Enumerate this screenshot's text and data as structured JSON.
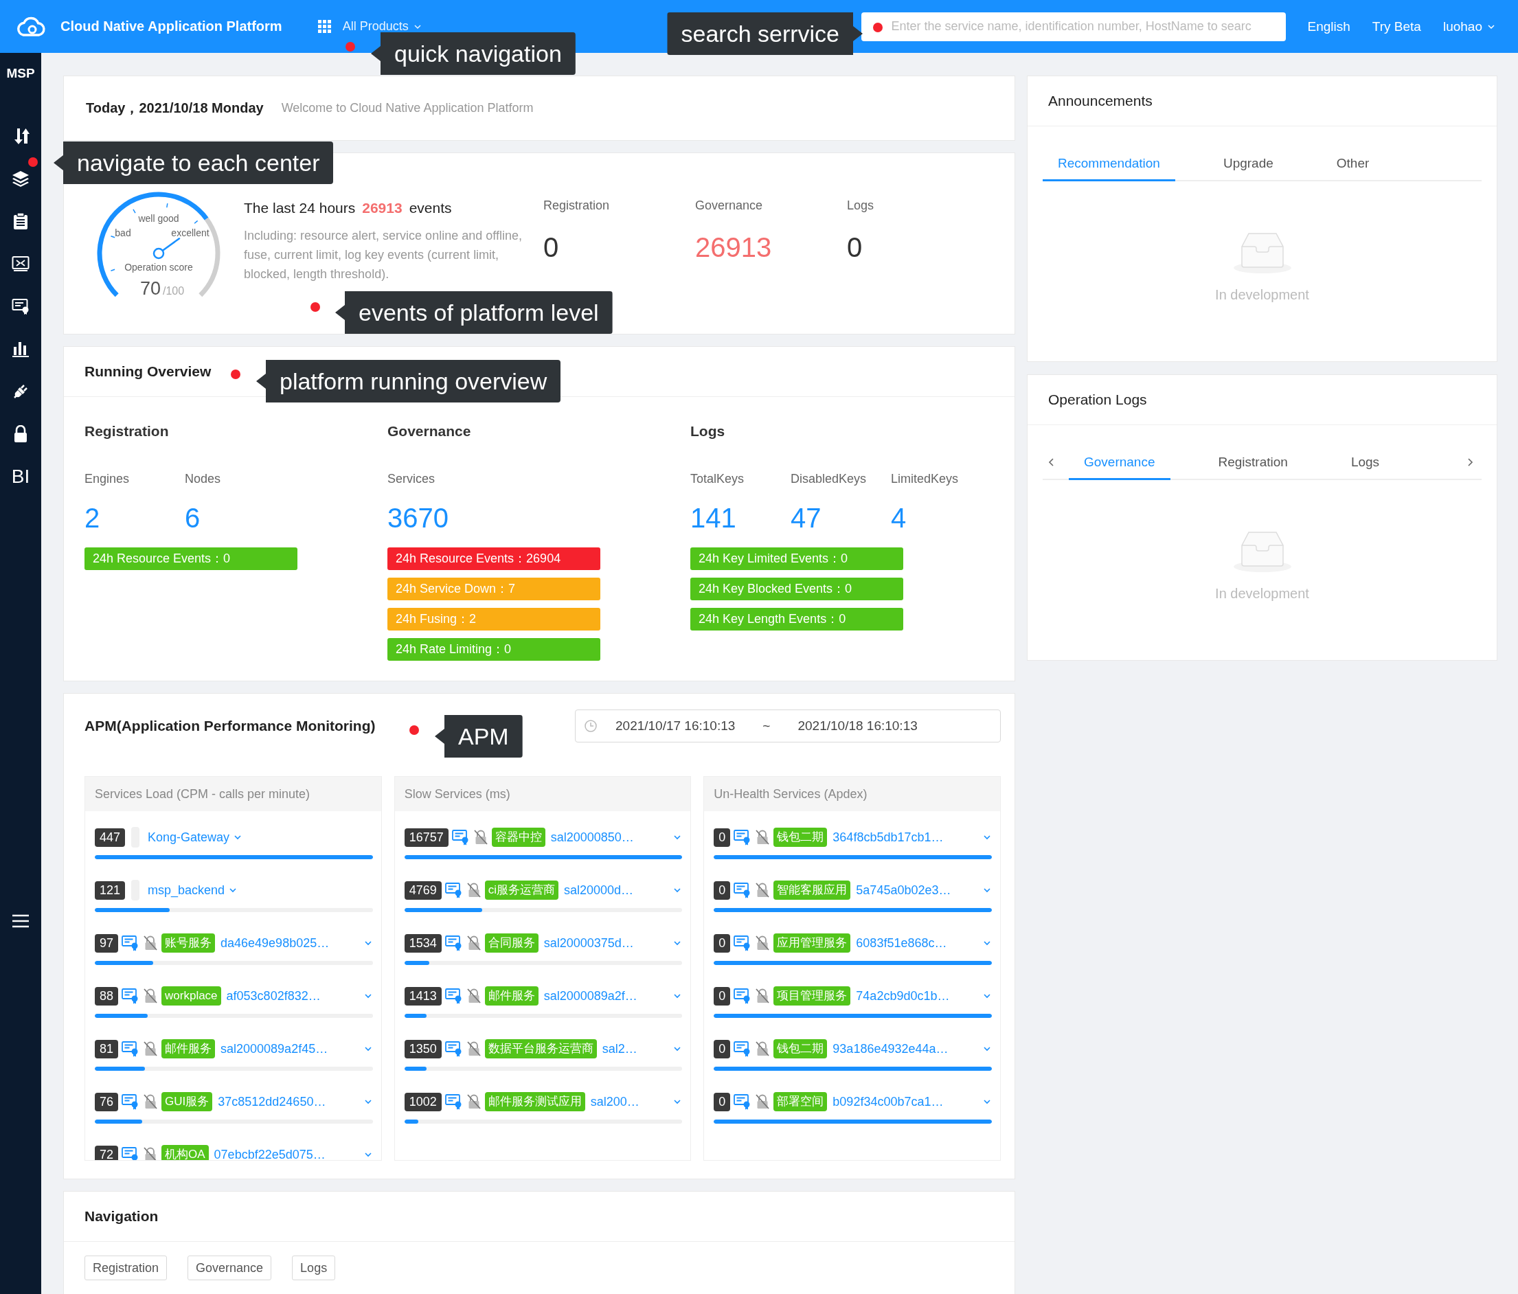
{
  "header": {
    "title": "Cloud Native Application Platform",
    "products": "All Products",
    "quick_nav_note": "quick navigation",
    "search": {
      "placeholder": "Enter the service name, identification number, HostName to searc"
    },
    "search_note": "search serrvice",
    "links": [
      "English",
      "Try Beta"
    ],
    "user": "luohao"
  },
  "sidebar": {
    "brand": "MSP",
    "note": "navigate to each center",
    "items": [
      {
        "kind": "transfer"
      },
      {
        "kind": "layers"
      },
      {
        "kind": "clipboard"
      },
      {
        "kind": "monitor"
      },
      {
        "kind": "certificate"
      },
      {
        "kind": "bars"
      },
      {
        "kind": "plug"
      },
      {
        "kind": "lock"
      },
      {
        "kind": "text",
        "label": "BI"
      }
    ]
  },
  "greeting": {
    "date": "Today，2021/10/18 Monday",
    "welcome": "Welcome to Cloud Native Application Platform"
  },
  "events": {
    "gauge": {
      "top_label": "well good",
      "left_label": "bad",
      "right_label": "excellent",
      "caption": "Operation score",
      "score": "70",
      "max": "/100"
    },
    "summary": {
      "prefix": "The last 24 hours",
      "count": "26913",
      "suffix": "events",
      "description": "Including: resource alert, service online and offline, fuse, current limit, log key events (current limit, blocked, length threshold)."
    },
    "stats": [
      {
        "label": "Registration",
        "value": "0",
        "color": "#333333"
      },
      {
        "label": "Governance",
        "value": "26913",
        "color": "#f46e6e"
      },
      {
        "label": "Logs",
        "value": "0",
        "color": "#333333"
      }
    ],
    "note": "events of platform level"
  },
  "overview": {
    "title": "Running Overview",
    "note": "platform running overview",
    "groups": [
      {
        "title": "Registration",
        "metrics": [
          {
            "label": "Engines",
            "value": "2"
          },
          {
            "label": "Nodes",
            "value": "6"
          }
        ],
        "events": [
          {
            "text": "24h Resource Events：0",
            "color": "#52c41a"
          }
        ]
      },
      {
        "title": "Governance",
        "metrics": [
          {
            "label": "Services",
            "value": "3670"
          }
        ],
        "events": [
          {
            "text": "24h Resource Events：26904",
            "color": "#f5222d"
          },
          {
            "text": "24h Service Down：7",
            "color": "#faad14"
          },
          {
            "text": "24h Fusing：2",
            "color": "#faad14"
          },
          {
            "text": "24h Rate Limiting：0",
            "color": "#52c41a"
          }
        ]
      },
      {
        "title": "Logs",
        "metrics": [
          {
            "label": "TotalKeys",
            "value": "141"
          },
          {
            "label": "DisabledKeys",
            "value": "47"
          },
          {
            "label": "LimitedKeys",
            "value": "4"
          }
        ],
        "events": [
          {
            "text": "24h Key Limited Events：0",
            "color": "#52c41a"
          },
          {
            "text": "24h Key Blocked Events：0",
            "color": "#52c41a"
          },
          {
            "text": "24h Key Length Events：0",
            "color": "#52c41a"
          }
        ]
      }
    ]
  },
  "apm": {
    "title": "APM(Application Performance Monitoring)",
    "note": "APM",
    "range": {
      "start": "2021/10/17 16:10:13",
      "separator": "~",
      "end": "2021/10/18 16:10:13"
    },
    "panels": [
      {
        "title": "Services Load (CPM - calls per minute)",
        "rows": [
          {
            "kind": "plain",
            "count": "447",
            "name": "Kong-Gateway",
            "level": 1
          },
          {
            "kind": "plain",
            "count": "121",
            "name": "msp_backend",
            "level": 0.27
          },
          {
            "kind": "tagged",
            "count": "97",
            "tag": "账号服务",
            "name": "da46e49e98b025…",
            "level": 0.21
          },
          {
            "kind": "tagged",
            "count": "88",
            "tag": "workplace",
            "name": "af053c802f832…",
            "level": 0.19
          },
          {
            "kind": "tagged",
            "count": "81",
            "tag": "邮件服务",
            "name": "sal2000089a2f45…",
            "level": 0.18
          },
          {
            "kind": "tagged",
            "count": "76",
            "tag": "GUI服务",
            "name": "37c8512dd24650…",
            "level": 0.17
          },
          {
            "kind": "tagged",
            "count": "72",
            "tag": "机构OA",
            "name": "07ebcbf22e5d075…"
          }
        ]
      },
      {
        "title": "Slow Services (ms)",
        "rows": [
          {
            "kind": "tagged",
            "count": "16757",
            "tag": "容器中控",
            "name": "sal20000850…",
            "level": 1
          },
          {
            "kind": "tagged",
            "count": "4769",
            "tag": "ci服务运营商",
            "name": "sal20000d…",
            "level": 0.28
          },
          {
            "kind": "tagged",
            "count": "1534",
            "tag": "合同服务",
            "name": "sal20000375d…",
            "level": 0.09
          },
          {
            "kind": "tagged",
            "count": "1413",
            "tag": "邮件服务",
            "name": "sal2000089a2f…",
            "level": 0.08
          },
          {
            "kind": "tagged",
            "count": "1350",
            "tag": "数据平台服务运营商",
            "name": "sal2…",
            "level": 0.08
          },
          {
            "kind": "tagged",
            "count": "1002",
            "tag": "邮件服务测试应用",
            "name": "sal200…",
            "level": 0.05
          }
        ]
      },
      {
        "title": "Un-Health Services (Apdex)",
        "rows": [
          {
            "kind": "tagged",
            "count": "0",
            "tag": "钱包二期",
            "name": "364f8cb5db17cb1…",
            "level": 1
          },
          {
            "kind": "tagged",
            "count": "0",
            "tag": "智能客服应用",
            "name": "5a745a0b02e3…",
            "level": 1
          },
          {
            "kind": "tagged",
            "count": "0",
            "tag": "应用管理服务",
            "name": "6083f51e868c…",
            "level": 1
          },
          {
            "kind": "tagged",
            "count": "0",
            "tag": "项目管理服务",
            "name": "74a2cb9d0c1b…",
            "level": 1
          },
          {
            "kind": "tagged",
            "count": "0",
            "tag": "钱包二期",
            "name": "93a186e4932e44a…",
            "level": 1
          },
          {
            "kind": "tagged",
            "count": "0",
            "tag": "部署空间",
            "name": "b092f34c00b7ca1…",
            "level": 1
          }
        ]
      }
    ]
  },
  "navigation": {
    "title": "Navigation",
    "buttons": [
      "Registration",
      "Governance",
      "Logs"
    ]
  },
  "announcements": {
    "title": "Announcements",
    "tabs": [
      {
        "label": "Recommendation",
        "selected": true
      },
      {
        "label": "Upgrade",
        "selected": false
      },
      {
        "label": "Other",
        "selected": false
      }
    ],
    "empty": "In development"
  },
  "operation_logs": {
    "title": "Operation Logs",
    "tabs": [
      {
        "label": "Governance",
        "selected": true
      },
      {
        "label": "Registration",
        "selected": false
      },
      {
        "label": "Logs",
        "selected": false
      }
    ],
    "empty": "In development"
  }
}
